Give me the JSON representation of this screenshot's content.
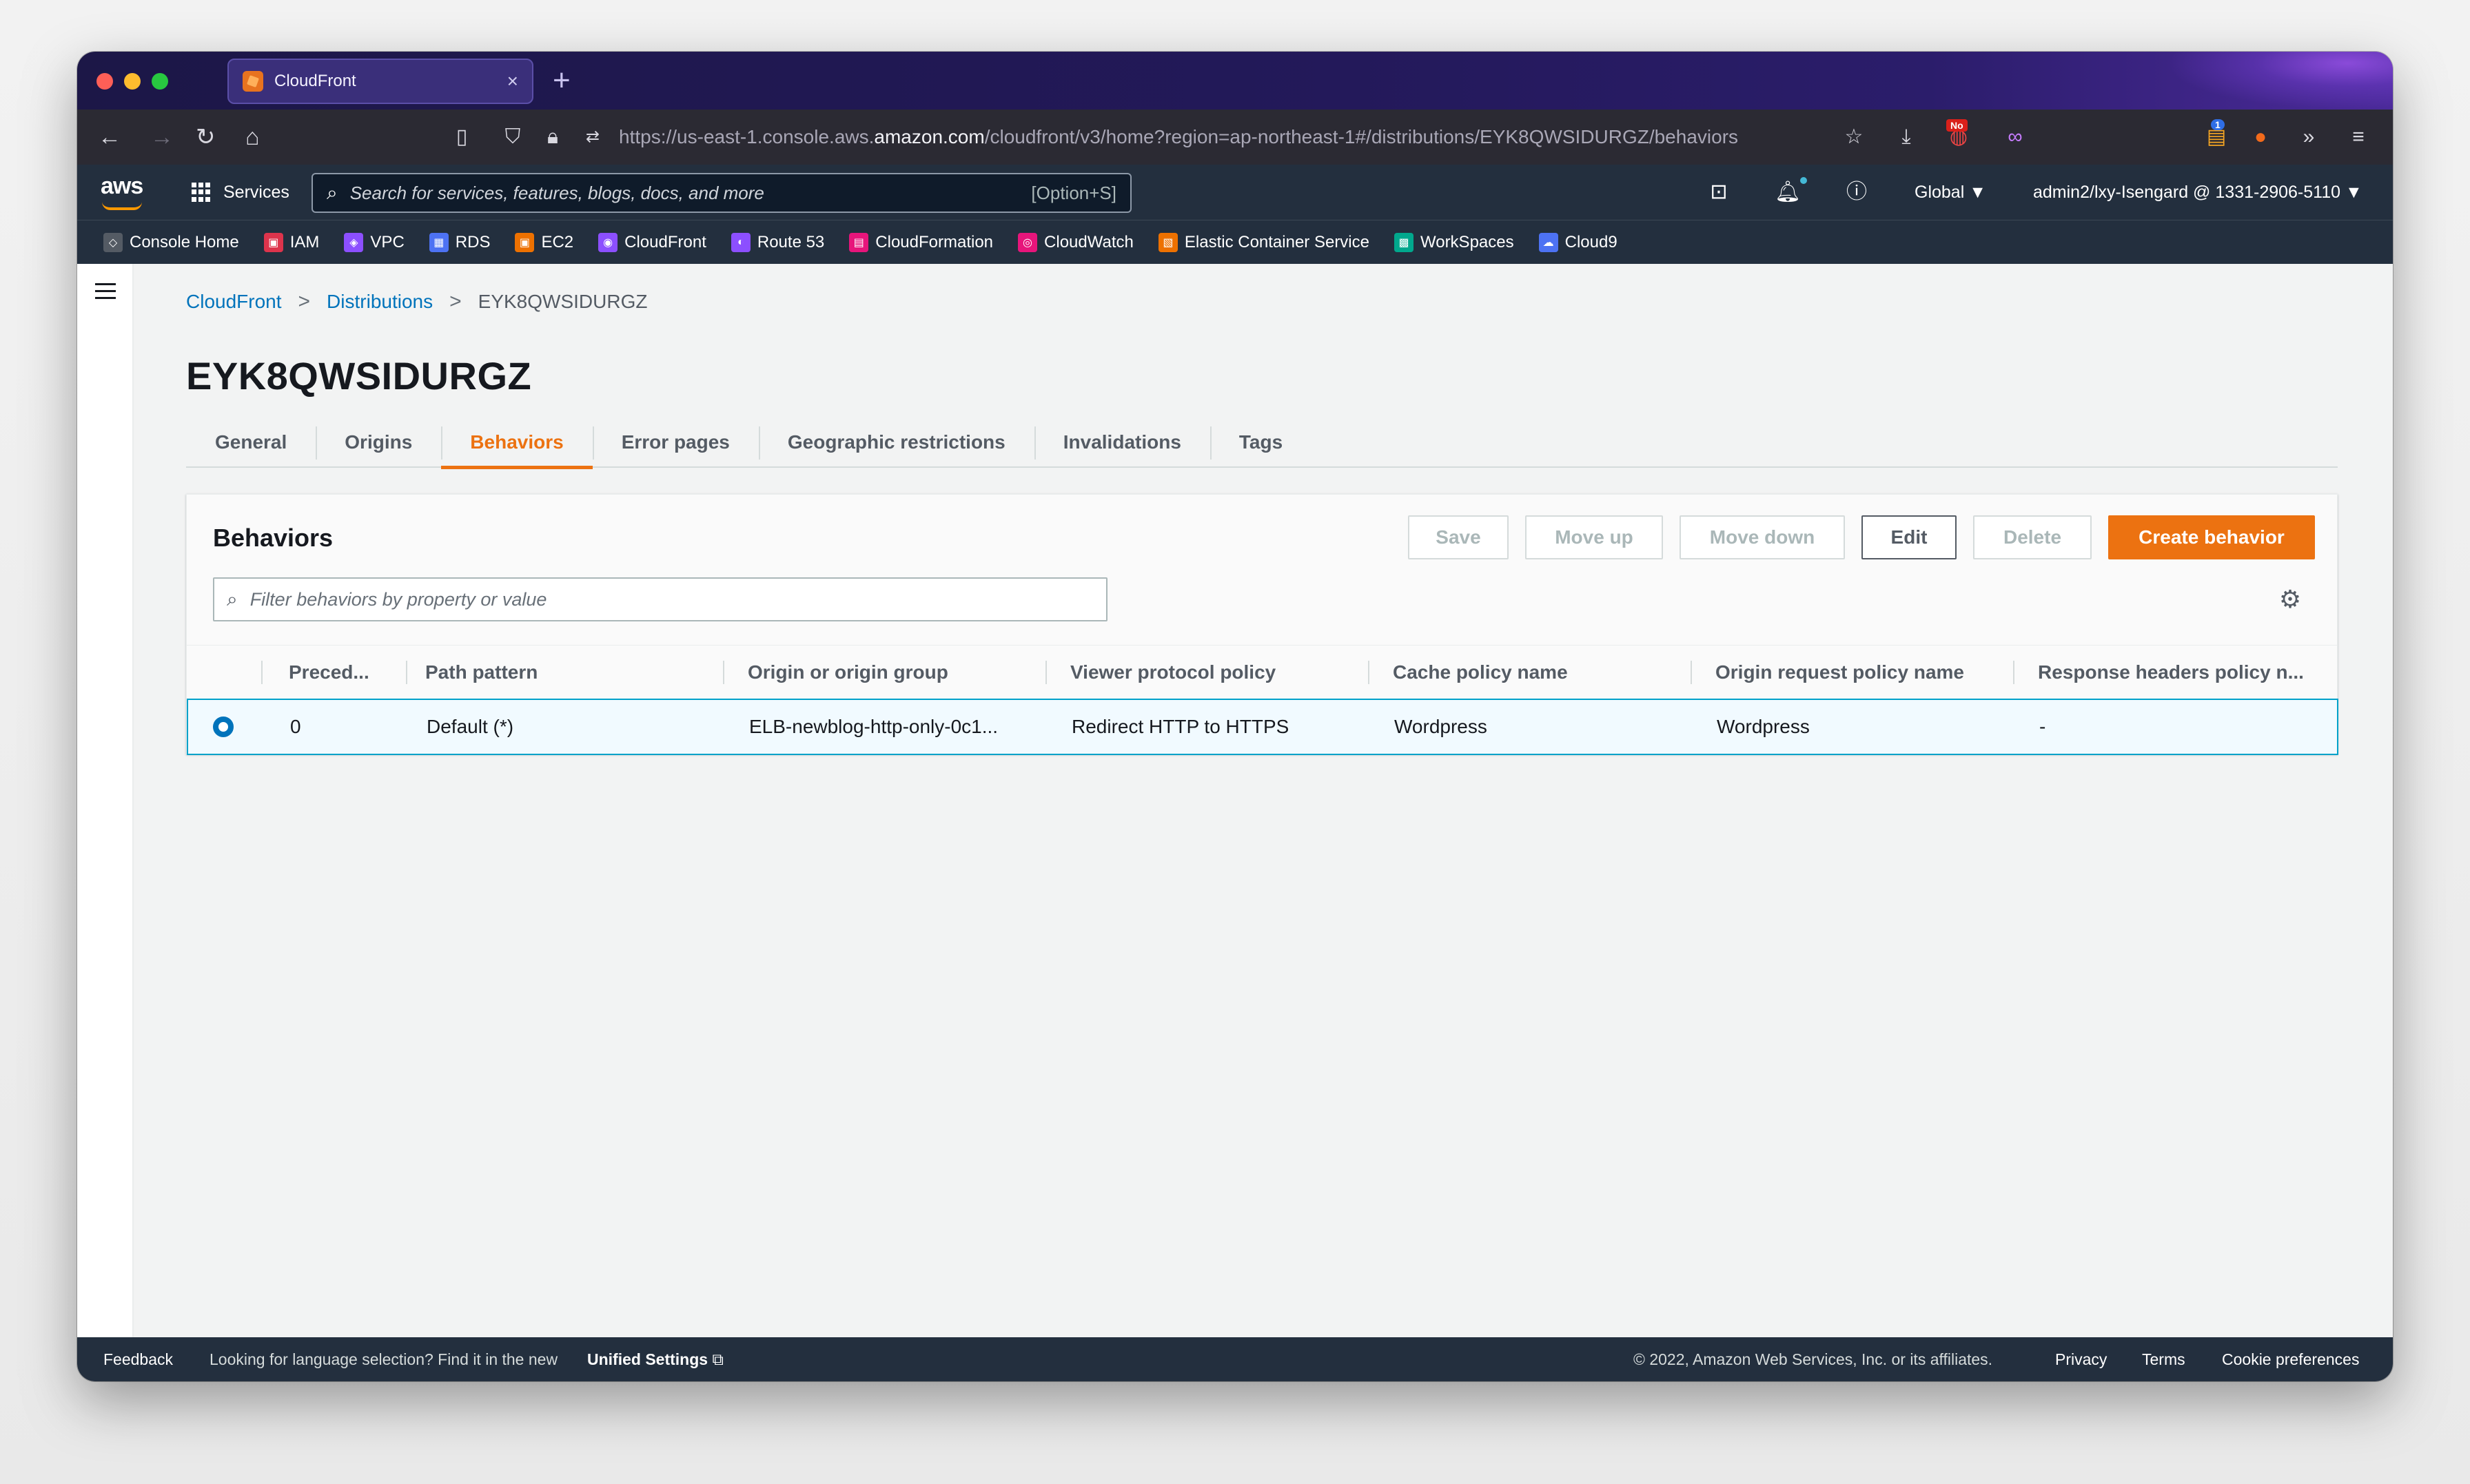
{
  "browser": {
    "tab_title": "CloudFront",
    "new_tab": "+",
    "tab_close": "×",
    "url_prefix": "https://us-east-1.console.aws.",
    "url_domain": "amazon.com",
    "url_path": "/cloudfront/v3/home?region=ap-northeast-1#/distributions/EYK8QWSIDURGZ/behaviors",
    "badge_no": "No",
    "badge_count": "1"
  },
  "aws_nav": {
    "logo": "aws",
    "services_label": "Services",
    "search_placeholder": "Search for services, features, blogs, docs, and more",
    "search_shortcut": "[Option+S]",
    "region": "Global ▼",
    "account": "admin2/lxy-Isengard @ 1331-2906-5110 ▼"
  },
  "favorites": [
    {
      "label": "Console Home",
      "color": "#545b64",
      "glyph": "◇"
    },
    {
      "label": "IAM",
      "color": "#dd344c",
      "glyph": "▣"
    },
    {
      "label": "VPC",
      "color": "#8c4fff",
      "glyph": "◈"
    },
    {
      "label": "RDS",
      "color": "#4d72f3",
      "glyph": "▦"
    },
    {
      "label": "EC2",
      "color": "#ed7100",
      "glyph": "▣"
    },
    {
      "label": "CloudFront",
      "color": "#8c4fff",
      "glyph": "◉"
    },
    {
      "label": "Route 53",
      "color": "#8c4fff",
      "glyph": "◐"
    },
    {
      "label": "CloudFormation",
      "color": "#e7157b",
      "glyph": "▤"
    },
    {
      "label": "CloudWatch",
      "color": "#e7157b",
      "glyph": "◎"
    },
    {
      "label": "Elastic Container Service",
      "color": "#ed7100",
      "glyph": "▧"
    },
    {
      "label": "WorkSpaces",
      "color": "#01a88d",
      "glyph": "▩"
    },
    {
      "label": "Cloud9",
      "color": "#4d72f3",
      "glyph": "☁"
    }
  ],
  "breadcrumb": {
    "item1": "CloudFront",
    "item2": "Distributions",
    "current": "EYK8QWSIDURGZ",
    "separator": ">"
  },
  "page_title": "EYK8QWSIDURGZ",
  "tabs": [
    {
      "label": "General",
      "active": false
    },
    {
      "label": "Origins",
      "active": false
    },
    {
      "label": "Behaviors",
      "active": true
    },
    {
      "label": "Error pages",
      "active": false
    },
    {
      "label": "Geographic restrictions",
      "active": false
    },
    {
      "label": "Invalidations",
      "active": false
    },
    {
      "label": "Tags",
      "active": false
    }
  ],
  "behaviors": {
    "title": "Behaviors",
    "buttons": {
      "save": "Save",
      "move_up": "Move up",
      "move_down": "Move down",
      "edit": "Edit",
      "delete": "Delete",
      "create": "Create behavior"
    },
    "filter_placeholder": "Filter behaviors by property or value",
    "columns": [
      "Preced...",
      "Path pattern",
      "Origin or origin group",
      "Viewer protocol policy",
      "Cache policy name",
      "Origin request policy name",
      "Response headers policy n..."
    ],
    "rows": [
      {
        "precedence": "0",
        "path_pattern": "Default (*)",
        "origin": "ELB-newblog-http-only-0c1...",
        "viewer_protocol": "Redirect HTTP to HTTPS",
        "cache_policy": "Wordpress",
        "origin_request_policy": "Wordpress",
        "response_headers_policy": "-",
        "selected": true
      }
    ]
  },
  "footer": {
    "feedback": "Feedback",
    "language_notice": "Looking for language selection? Find it in the new",
    "unified_settings": "Unified Settings",
    "copyright": "© 2022, Amazon Web Services, Inc. or its affiliates.",
    "privacy": "Privacy",
    "terms": "Terms",
    "cookies": "Cookie preferences"
  }
}
